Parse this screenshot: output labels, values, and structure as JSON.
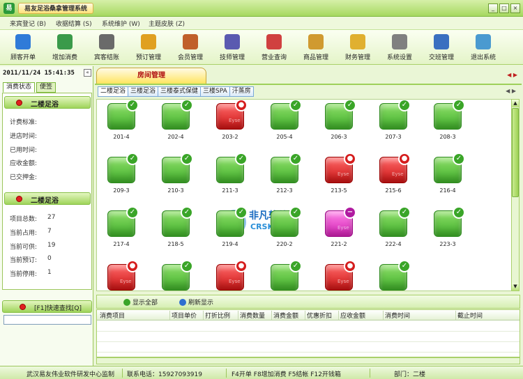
{
  "window": {
    "title": "易友足浴桑拿管理系统",
    "controls": [
      "_",
      "□",
      "×"
    ]
  },
  "menu": [
    "来宾登记 (B)",
    "收据结算 (S)",
    "系统维护 (W)",
    "主题皮肤 (Z)"
  ],
  "toolbar": [
    {
      "label": "顾客开单",
      "icon": "customer-open-icon",
      "color": "#2f7bd8"
    },
    {
      "label": "增加消费",
      "icon": "add-consume-icon",
      "color": "#3a9a4a"
    },
    {
      "label": "宾客结账",
      "icon": "checkout-printer-icon",
      "color": "#6a6a6a"
    },
    {
      "label": "预订管理",
      "icon": "reservation-icon",
      "color": "#e0a020"
    },
    {
      "label": "会员管理",
      "icon": "member-icon",
      "color": "#c0602a"
    },
    {
      "label": "技师管理",
      "icon": "technician-icon",
      "color": "#5a5ab0"
    },
    {
      "label": "营业查询",
      "icon": "business-query-icon",
      "color": "#d04040"
    },
    {
      "label": "商品管理",
      "icon": "goods-icon",
      "color": "#d09a30"
    },
    {
      "label": "财务管理",
      "icon": "finance-folder-icon",
      "color": "#e0b030"
    },
    {
      "label": "系统设置",
      "icon": "settings-gear-icon",
      "color": "#808080"
    },
    {
      "label": "交班管理",
      "icon": "shift-icon",
      "color": "#3a70c0"
    },
    {
      "label": "退出系统",
      "icon": "exit-icon",
      "color": "#4a9ad0"
    }
  ],
  "sidebar": {
    "datetime": "2011/11/24 15:41:35",
    "collapse": "«",
    "tabs": [
      "消费状态",
      "便签"
    ],
    "room_section_title": "二楼足浴",
    "room_fields": [
      "计费标准:",
      "进店时间:",
      "已用时间:",
      "应收金额:",
      "已交押金:"
    ],
    "stats_section_title": "二楼足浴",
    "stats": [
      {
        "label": "项目总数:",
        "value": "27"
      },
      {
        "label": "当前占用:",
        "value": "7"
      },
      {
        "label": "当前可供:",
        "value": "19"
      },
      {
        "label": "当前预订:",
        "value": "0"
      },
      {
        "label": "当前停用:",
        "value": "1"
      }
    ],
    "quick_search": "[F1]快速查找[Q]",
    "quick_search_value": ""
  },
  "main": {
    "page_tab": "房间管理",
    "nav_arrows": "◀ ▶",
    "floor_tabs": [
      "二楼足浴",
      "三楼足浴",
      "三楼泰式保健",
      "三楼SPA",
      "汗蒸房"
    ],
    "active_floor": 0,
    "room_label": "Eyse",
    "rooms": [
      {
        "number": "201-4",
        "status": "free"
      },
      {
        "number": "202-4",
        "status": "free"
      },
      {
        "number": "203-2",
        "status": "busy"
      },
      {
        "number": "205-4",
        "status": "free"
      },
      {
        "number": "206-3",
        "status": "free"
      },
      {
        "number": "207-3",
        "status": "free"
      },
      {
        "number": "208-3",
        "status": "free"
      },
      {
        "number": "209-3",
        "status": "free"
      },
      {
        "number": "210-3",
        "status": "free"
      },
      {
        "number": "211-3",
        "status": "free"
      },
      {
        "number": "212-3",
        "status": "free"
      },
      {
        "number": "213-5",
        "status": "busy"
      },
      {
        "number": "215-6",
        "status": "busy"
      },
      {
        "number": "216-4",
        "status": "free"
      },
      {
        "number": "217-4",
        "status": "free"
      },
      {
        "number": "218-5",
        "status": "free"
      },
      {
        "number": "219-4",
        "status": "free"
      },
      {
        "number": "220-2",
        "status": "free"
      },
      {
        "number": "221-2",
        "status": "reserved"
      },
      {
        "number": "222-4",
        "status": "free"
      },
      {
        "number": "223-3",
        "status": "free"
      },
      {
        "number": "",
        "status": "busy"
      },
      {
        "number": "",
        "status": "free"
      },
      {
        "number": "",
        "status": "busy"
      },
      {
        "number": "",
        "status": "free"
      },
      {
        "number": "",
        "status": "busy"
      },
      {
        "number": "",
        "status": "free"
      }
    ],
    "watermark": {
      "title": "非凡软件站",
      "subtitle": "CRSKY.com"
    },
    "buttons": [
      "显示全部",
      "刷新显示"
    ],
    "table_headers": [
      "消费项目",
      "项目单价",
      "打折比例",
      "消费数量",
      "消费金额",
      "优惠折扣",
      "应收金额",
      "消费时间",
      "截止时间"
    ]
  },
  "status_bar": {
    "company": "武汉易友伟业软件研发中心监制",
    "phone": "联系电话：15927093919",
    "shortcuts": "F4开单  F8增加消费  F5结帐  F12开钱箱",
    "department": "部门：二楼"
  },
  "colors": {
    "free": "#3fae2a",
    "busy": "#cc1414",
    "reserved": "#d320b4",
    "accent": "#9fd45a"
  }
}
